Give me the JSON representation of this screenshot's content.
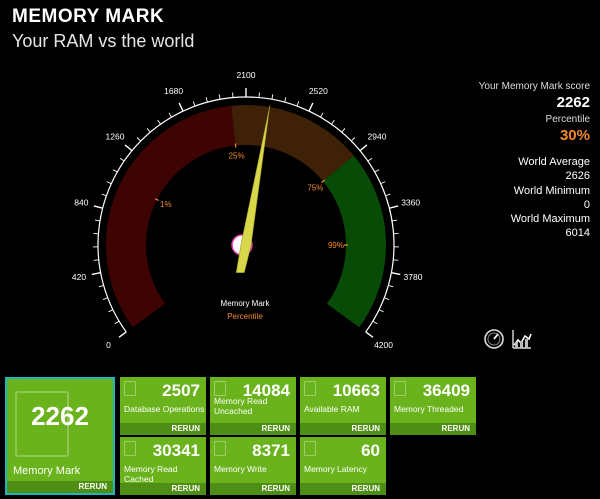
{
  "header": {
    "title": "MEMORY MARK",
    "subtitle": "Your RAM vs the world"
  },
  "gauge": {
    "ticks": [
      "0",
      "420",
      "840",
      "1260",
      "1680",
      "2100",
      "2520",
      "2940",
      "3360",
      "3780",
      "4200"
    ],
    "min": 0,
    "max": 4200,
    "needle_value": 2262,
    "percentile_markers": [
      {
        "label": "1%",
        "at": 1050
      },
      {
        "label": "25%",
        "at": 2000
      },
      {
        "label": "75%",
        "at": 2940
      },
      {
        "label": "99%",
        "at": 3600
      }
    ],
    "center_label": "Memory Mark",
    "center_sublabel": "Percentile",
    "colors": {
      "low": "#3e0404",
      "mid": "#3e2107",
      "high": "#074b07",
      "needle": "#d8d84a",
      "pct_text": "#f28a2b"
    }
  },
  "summary": {
    "score_label": "Your Memory Mark score",
    "score": "2262",
    "percentile_label": "Percentile",
    "percentile": "30%",
    "avg_label": "World Average",
    "avg": "2626",
    "min_label": "World Minimum",
    "min": "0",
    "max_label": "World Maximum",
    "max": "6014"
  },
  "icons": {
    "gauge": "speedometer-icon",
    "chart": "chart-icon"
  },
  "tiles": {
    "main": {
      "value": "2262",
      "label": "Memory Mark",
      "rerun": "RERUN"
    },
    "db": {
      "value": "2507",
      "label": "Database Operations",
      "rerun": "RERUN"
    },
    "read_uncached": {
      "value": "14084",
      "label": "Memory Read Uncached",
      "rerun": "RERUN"
    },
    "avail": {
      "value": "10663",
      "label": "Available RAM",
      "rerun": "RERUN"
    },
    "threaded": {
      "value": "36409",
      "label": "Memory Threaded",
      "rerun": "RERUN"
    },
    "read_cached": {
      "value": "30341",
      "label": "Memory Read Cached",
      "rerun": "RERUN"
    },
    "write": {
      "value": "8371",
      "label": "Memory Write",
      "rerun": "RERUN"
    },
    "latency": {
      "value": "60",
      "label": "Memory Latency",
      "rerun": "RERUN"
    }
  }
}
